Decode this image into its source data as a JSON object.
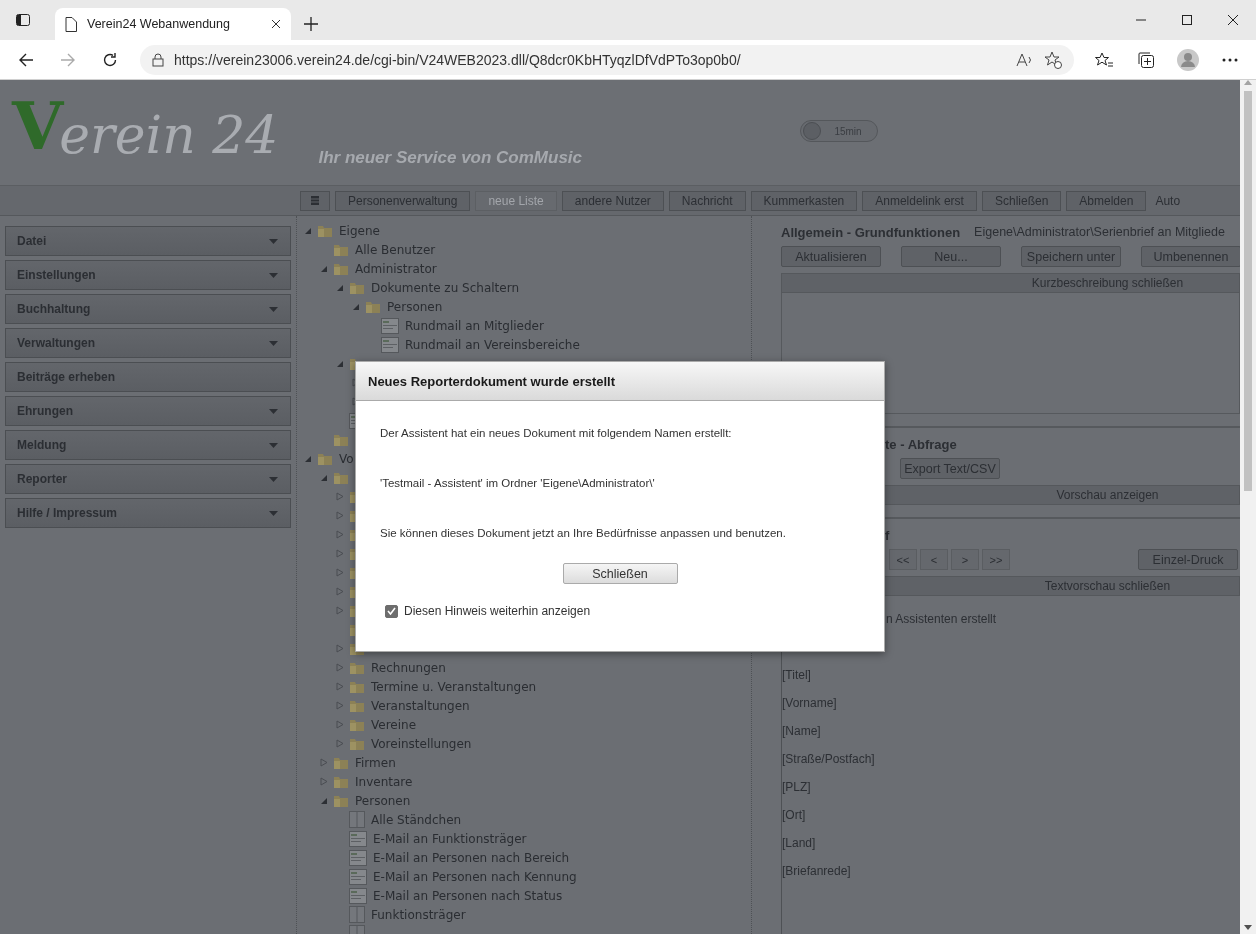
{
  "browser": {
    "tab_title": "Verein24 Webanwendung",
    "url": "https://verein23006.verein24.de/cgi-bin/V24WEB2023.dll/Q8dcr0KbHTyqzlDfVdPTo3op0b0/"
  },
  "header": {
    "logo_initial": "V",
    "logo_rest": "erein 24",
    "slogan": "Ihr neuer Service von ComMusic",
    "timer": {
      "label": "15min",
      "on": false
    }
  },
  "toolbar": [
    {
      "kind": "icon",
      "disabled": false
    },
    {
      "kind": "text",
      "label": "Personenverwaltung",
      "disabled": false
    },
    {
      "kind": "text",
      "label": "neue Liste",
      "disabled": true
    },
    {
      "kind": "text",
      "label": "andere Nutzer",
      "disabled": false
    },
    {
      "kind": "text",
      "label": "Nachricht",
      "disabled": false
    },
    {
      "kind": "text",
      "label": "Kummerkasten",
      "disabled": false
    },
    {
      "kind": "text",
      "label": "Anmeldelink erst",
      "disabled": false
    },
    {
      "kind": "text",
      "label": "Schließen",
      "disabled": false
    },
    {
      "kind": "text",
      "label": "Abmelden",
      "disabled": false
    },
    {
      "kind": "cut",
      "label": "Auto",
      "disabled": false
    }
  ],
  "sidebar": {
    "items": [
      {
        "label": "Datei",
        "expandable": true
      },
      {
        "label": "Einstellungen",
        "expandable": true
      },
      {
        "label": "Buchhaltung",
        "expandable": true
      },
      {
        "label": "Verwaltungen",
        "expandable": true
      },
      {
        "label": "Beiträge erheben",
        "expandable": false
      },
      {
        "label": "Ehrungen",
        "expandable": true
      },
      {
        "label": "Meldung",
        "expandable": true
      },
      {
        "label": "Reporter",
        "expandable": true
      },
      {
        "label": "Hilfe / Impressum",
        "expandable": true
      }
    ]
  },
  "tree": [
    {
      "label": "Eigene",
      "kind": "folder",
      "expanded": true,
      "children": [
        {
          "label": "Alle Benutzer",
          "kind": "folder"
        },
        {
          "label": "Administrator",
          "kind": "folder",
          "expanded": true,
          "children": [
            {
              "label": "Dokumente zu Schaltern",
              "kind": "folder",
              "expanded": true,
              "children": [
                {
                  "label": "Personen",
                  "kind": "folder",
                  "expanded": true,
                  "children": [
                    {
                      "label": "Rundmail an Mitglieder",
                      "kind": "document"
                    },
                    {
                      "label": "Rundmail an Vereinsbereiche",
                      "kind": "document"
                    }
                  ]
                }
              ]
            },
            {
              "kind": "folder",
              "expanded": true,
              "children": [
                {
                  "kind": "folder",
                  "expanded": false
                },
                {
                  "kind": "folder",
                  "expanded": false
                }
              ]
            },
            {
              "kind": "document"
            }
          ]
        },
        {
          "kind": "folder"
        }
      ]
    },
    {
      "label": "Vo",
      "kind": "folder",
      "expanded": true,
      "children": [
        {
          "kind": "folder",
          "expanded": true,
          "children": [
            {
              "kind": "folder",
              "expanded": false
            },
            {
              "kind": "folder",
              "expanded": false
            },
            {
              "kind": "folder",
              "expanded": false
            },
            {
              "kind": "folder",
              "expanded": false
            },
            {
              "kind": "folder",
              "expanded": false
            },
            {
              "kind": "folder",
              "expanded": false
            },
            {
              "kind": "folder",
              "expanded": false
            },
            {
              "kind": "folder"
            },
            {
              "kind": "folder",
              "expanded": false
            },
            {
              "label": "Rechnungen",
              "kind": "folder",
              "expanded": false
            },
            {
              "label": "Termine u. Veranstaltungen",
              "kind": "folder",
              "expanded": false
            },
            {
              "label": "Veranstaltungen",
              "kind": "folder",
              "expanded": false
            },
            {
              "label": "Vereine",
              "kind": "folder",
              "expanded": false
            },
            {
              "label": "Voreinstellungen",
              "kind": "folder",
              "expanded": false
            }
          ]
        },
        {
          "label": "Firmen",
          "kind": "folder",
          "expanded": false
        },
        {
          "label": "Inventare",
          "kind": "folder",
          "expanded": false
        },
        {
          "label": "Personen",
          "kind": "folder",
          "expanded": true,
          "children": [
            {
              "label": "Alle Ständchen",
              "kind": "table"
            },
            {
              "label": "E-Mail an Funktionsträger",
              "kind": "document"
            },
            {
              "label": "E-Mail an Personen nach Bereich",
              "kind": "document"
            },
            {
              "label": "E-Mail an Personen nach Kennung",
              "kind": "document"
            },
            {
              "label": "E-Mail an Personen nach Status",
              "kind": "document"
            },
            {
              "label": "Funktionsträger",
              "kind": "table"
            },
            {
              "kind": "table"
            }
          ]
        }
      ]
    }
  ],
  "panel": {
    "title": "Allgemein - Grundfunktionen",
    "path": "Eigene\\Administrator\\Serienbrief an Mitgliede",
    "buttons": [
      "Aktualisieren",
      "Neu...",
      "Speichern unter",
      "Umbenennen"
    ],
    "description_bar": "Kurzbeschreibung schließen",
    "query_title": "te - Abfrage",
    "query_buttons": [
      "Export Text/CSV"
    ],
    "preview_bar": "Vorschau anzeigen",
    "letter_title": "f",
    "nav_buttons": [
      "<<",
      "<",
      ">",
      ">>"
    ],
    "print_button": "Einzel-Druck",
    "text_bar": "Textvorschau schließen",
    "text_lines": [
      "n Assistenten erstellt",
      "[Titel]",
      "[Vorname]",
      "[Name]",
      "[Straße/Postfach]",
      "[PLZ]",
      "[Ort]",
      "[Land]",
      "[Briefanrede]"
    ]
  },
  "dialog": {
    "title": "Neues Reporterdokument wurde erstellt",
    "messages": [
      "Der Assistent hat ein neues Dokument mit folgendem Namen erstellt:",
      "'Testmail - Assistent' im Ordner 'Eigene\\Administrator\\'",
      "Sie können dieses Dokument jetzt an Ihre Bedürfnisse anpassen und benutzen."
    ],
    "button": "Schließen",
    "checkbox": {
      "label": "Diesen Hinweis weiterhin anzeigen",
      "checked": true
    }
  }
}
